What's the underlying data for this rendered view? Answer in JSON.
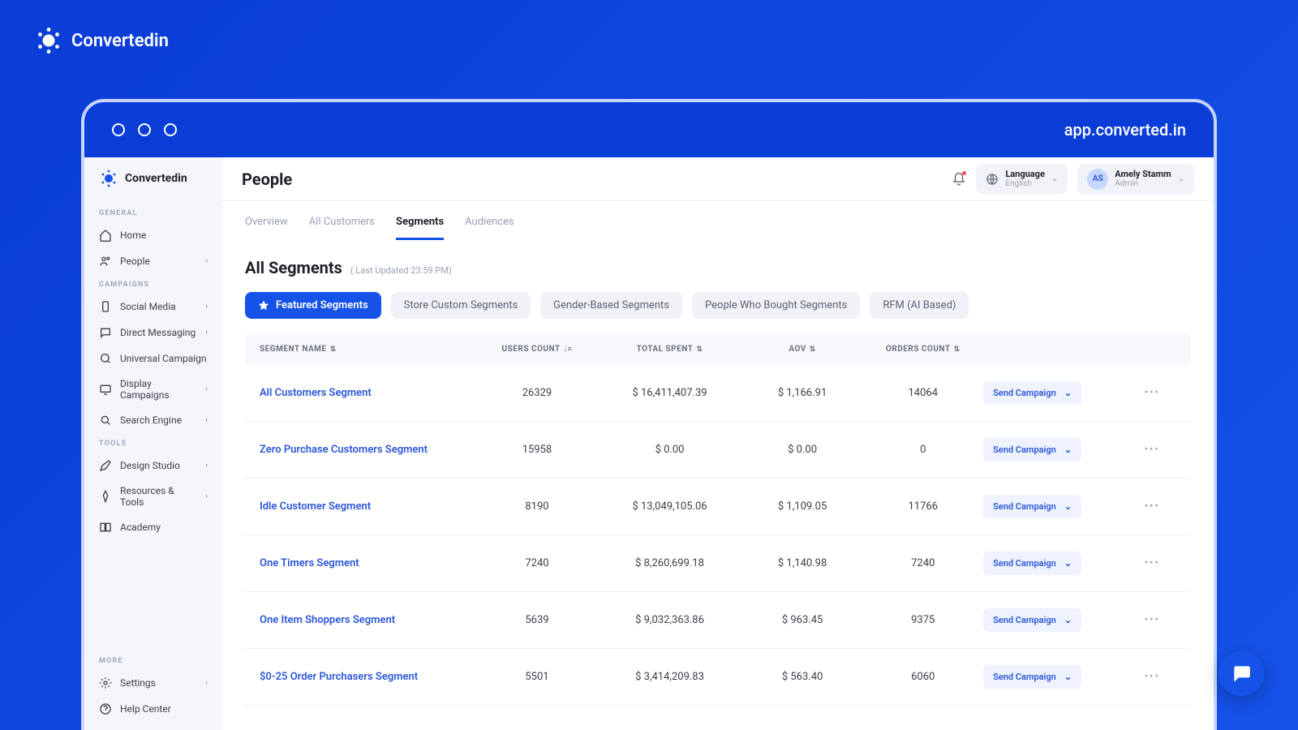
{
  "brand": "Convertedin",
  "url": "app.converted.in",
  "sidebar": {
    "sections": {
      "general": "GENERAL",
      "campaigns": "CAMPAIGNS",
      "tools": "TOOLS",
      "more": "MORE"
    },
    "items": {
      "home": "Home",
      "people": "People",
      "social_media": "Social Media",
      "direct_messaging": "Direct Messaging",
      "universal_campaign": "Universal Campaign",
      "display_campaigns": "Display Campaigns",
      "search_engine": "Search Engine",
      "design_studio": "Design Studio",
      "resources_tools": "Resources & Tools",
      "academy": "Academy",
      "settings": "Settings",
      "help_center": "Help Center"
    }
  },
  "header": {
    "title": "People",
    "language_label": "Language",
    "language_value": "English",
    "user_name": "Amely Stamm",
    "user_role": "Admin",
    "user_initials": "AS"
  },
  "tabs": {
    "overview": "Overview",
    "all_customers": "All Customers",
    "segments": "Segments",
    "audiences": "Audiences"
  },
  "segments": {
    "heading": "All Segments",
    "last_updated": "( Last Updated 23:59 PM)",
    "filters": {
      "featured": "Featured Segments",
      "store_custom": "Store Custom Segments",
      "gender": "Gender-Based Segments",
      "bought": "People Who Bought Segments",
      "rfm": "RFM (AI Based)"
    },
    "columns": {
      "name": "SEGMENT NAME",
      "users": "USERS COUNT",
      "spent": "TOTAL SPENT",
      "aov": "AOV",
      "orders": "ORDERS COUNT"
    },
    "action_label": "Send Campaign",
    "rows": [
      {
        "name": "All Customers Segment",
        "users": "26329",
        "spent": "$ 16,411,407.39",
        "aov": "$ 1,166.91",
        "orders": "14064"
      },
      {
        "name": "Zero Purchase Customers Segment",
        "users": "15958",
        "spent": "$ 0.00",
        "aov": "$ 0.00",
        "orders": "0"
      },
      {
        "name": "Idle Customer Segment",
        "users": "8190",
        "spent": "$ 13,049,105.06",
        "aov": "$ 1,109.05",
        "orders": "11766"
      },
      {
        "name": "One Timers Segment",
        "users": "7240",
        "spent": "$  8,260,699.18",
        "aov": "$ 1,140.98",
        "orders": "7240"
      },
      {
        "name": "One Item Shoppers Segment",
        "users": "5639",
        "spent": "$  9,032,363.86",
        "aov": "$  963.45",
        "orders": "9375"
      },
      {
        "name": "$0-25 Order Purchasers Segment",
        "users": "5501",
        "spent": "$  3,414,209.83",
        "aov": "$  563.40",
        "orders": "6060"
      }
    ]
  }
}
